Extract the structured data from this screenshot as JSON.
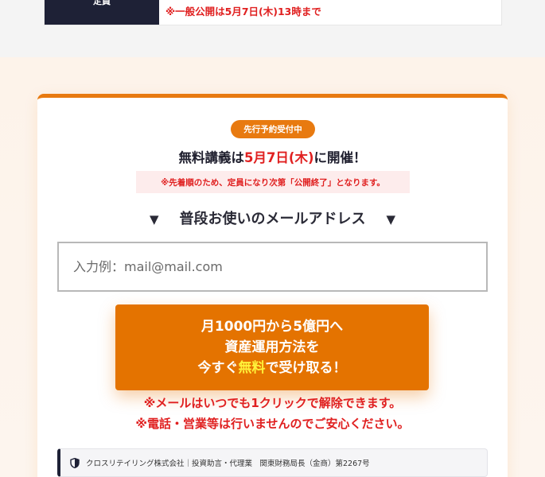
{
  "capacity": {
    "label": "定員",
    "value": "※一般公開は5月7日(木)13時まで"
  },
  "form": {
    "badge": "先行予約受付中",
    "headline_pre": "無料講義は",
    "headline_date": "5月7日(木)",
    "headline_post": "に開催！",
    "notice": "※先着順のため、定員になり次第「公開終了」となります。",
    "email_heading": "普段お使いのメールアドレス",
    "arrow_glyph": "▼",
    "email_placeholder": "入力例：mail@mail.com",
    "cta_line1": "月1000円から5億円へ",
    "cta_line2": "資産運用方法を",
    "cta_line3_pre": "今すぐ",
    "cta_line3_highlight": "無料",
    "cta_line3_post": "で受け取る！",
    "fine_print_1": "※メールはいつでも1クリックで解除できます。",
    "fine_print_2": "※電話・営業等は行いませんのでご安心ください。",
    "company_info": "クロスリテイリング株式会社｜投資助言・代理業　関東財務局長（金商）第2267号",
    "company_icon": "shield-icon"
  },
  "colors": {
    "accent": "#e87a10",
    "cta": "#e47300",
    "warning_red": "#e02020",
    "navy": "#1e2136",
    "highlight_yellow": "#fff23a"
  }
}
